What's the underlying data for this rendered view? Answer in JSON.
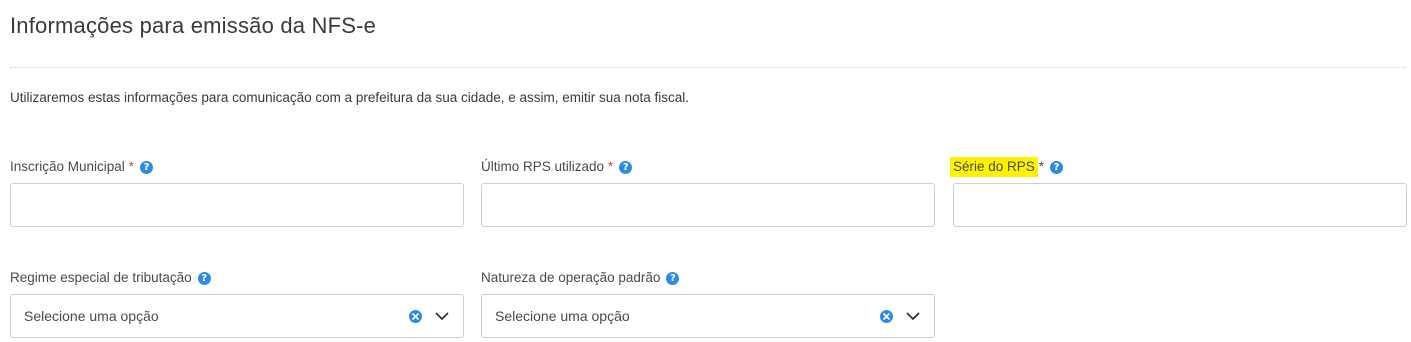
{
  "page": {
    "title": "Informações para emissão da NFS-e",
    "intro": "Utilizaremos estas informações para comunicação com a prefeitura da sua cidade, e assim, emitir sua nota fiscal."
  },
  "fields": {
    "inscricao": {
      "label": "Inscrição Municipal",
      "required_mark": "*",
      "value": ""
    },
    "ultimo_rps": {
      "label": "Último RPS utilizado",
      "required_mark": "*",
      "value": ""
    },
    "serie_rps": {
      "label": "Série do RPS",
      "required_mark": "*",
      "value": "",
      "highlight_color": "#fff200"
    },
    "regime": {
      "label": "Regime especial de tributação",
      "selected": "Selecione uma opção"
    },
    "natureza": {
      "label": "Natureza de operação padrão",
      "selected": "Selecione uma opção"
    }
  },
  "icons": {
    "help": "question-circle-icon",
    "clear": "x-circle-icon",
    "dropdown": "chevron-down-icon"
  },
  "colors": {
    "accent": "#2f8be0",
    "required": "#e0393e",
    "highlight": "#fff200",
    "border": "#cfcfcf"
  }
}
